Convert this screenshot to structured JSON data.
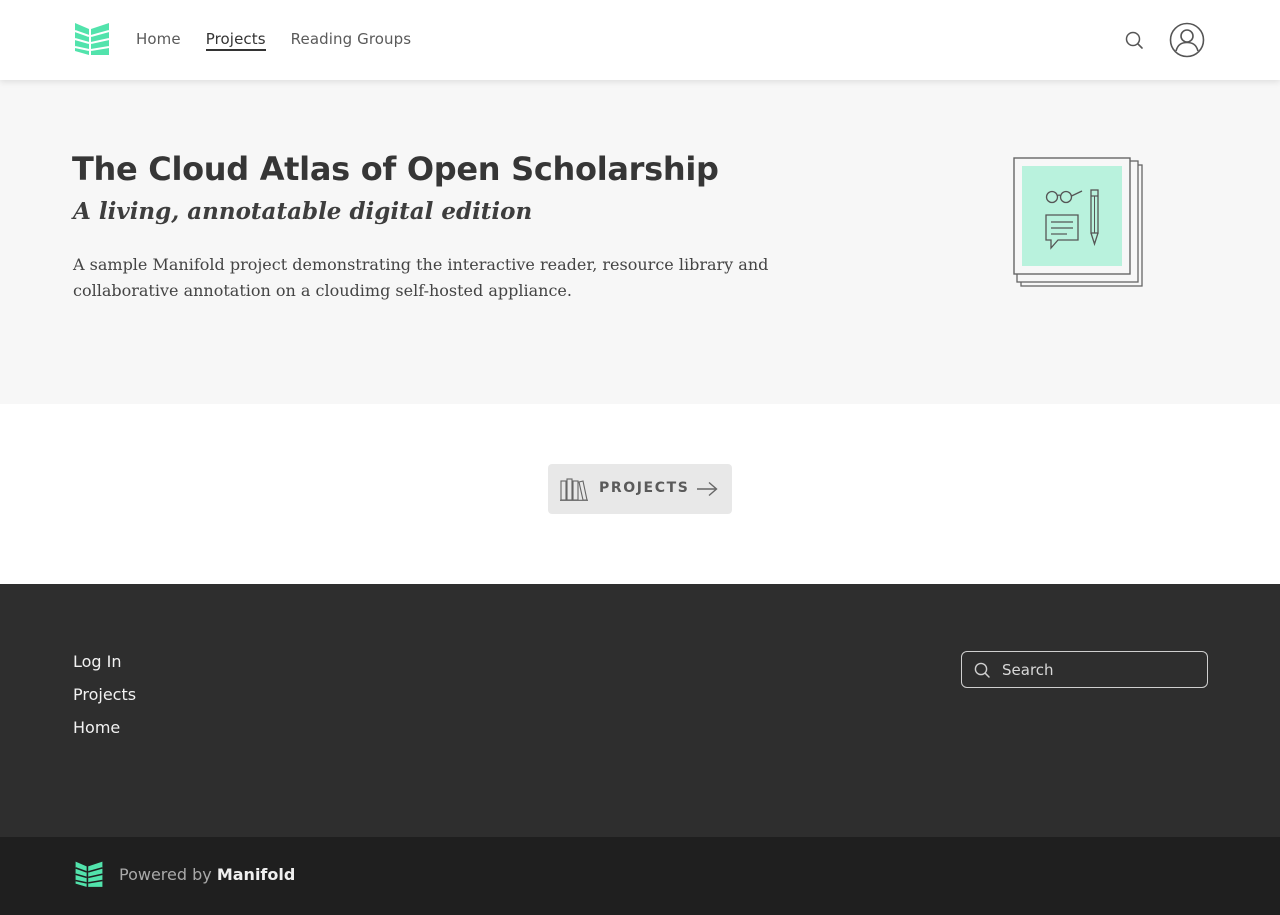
{
  "header": {
    "nav": [
      {
        "label": "Home"
      },
      {
        "label": "Projects",
        "active": true
      },
      {
        "label": "Reading Groups"
      }
    ],
    "icons": [
      "manifold-logo-icon",
      "search-icon",
      "user-avatar-icon"
    ]
  },
  "hero": {
    "title": "The Cloud Atlas of Open Scholarship",
    "subtitle": "A living, annotatable digital edition",
    "description": "A sample Manifold project demonstrating the interactive reader, resource library and collaborative annotation on a cloudimg self-hosted appliance.",
    "art_icon": "reading-annotation-icon"
  },
  "projects_button": {
    "label": "PROJECTS",
    "icons": [
      "books-icon",
      "arrow-right-icon"
    ]
  },
  "footer": {
    "links": [
      {
        "label": "Log In"
      },
      {
        "label": "Projects"
      },
      {
        "label": "Home"
      }
    ],
    "search": {
      "placeholder": "Search"
    }
  },
  "powered": {
    "prefix": "Powered by",
    "brand": "Manifold"
  },
  "colors": {
    "brand_accent": "#52e3ac",
    "footer_bg": "#2e2e2e",
    "bottom_bar_bg": "#1f1f1f",
    "hero_bg": "#f7f7f7"
  }
}
